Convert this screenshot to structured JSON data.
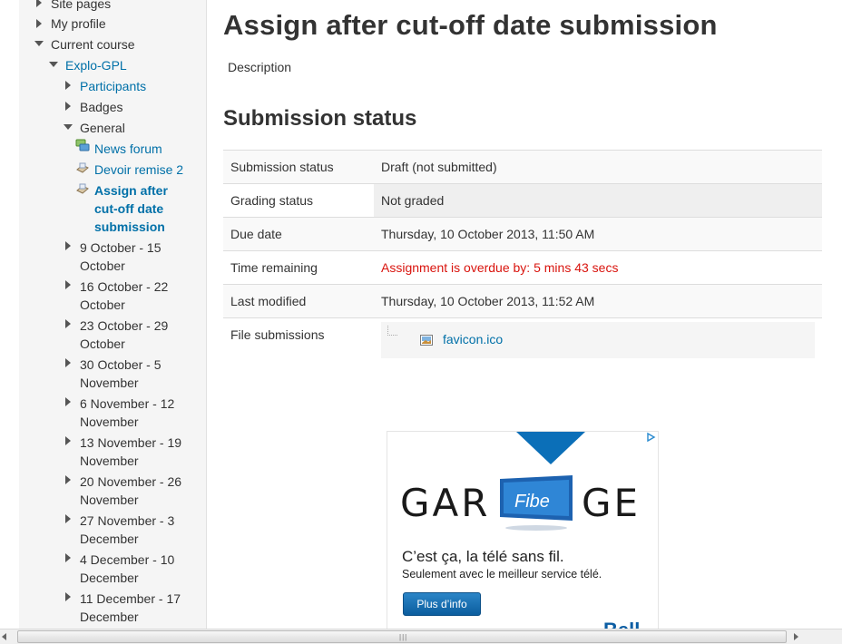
{
  "sidebar": {
    "site_pages": "Site pages",
    "my_profile": "My profile",
    "current_course": "Current course",
    "course_name": "Explo-GPL",
    "participants": "Participants",
    "badges": "Badges",
    "general": "General",
    "news_forum": "News forum",
    "devoir": "Devoir remise 2",
    "assign_lines": [
      "Assign after",
      "cut-off date",
      "submission"
    ],
    "weeks": [
      [
        "9 October - 15",
        "October"
      ],
      [
        "16 October - 22",
        "October"
      ],
      [
        "23 October - 29",
        "October"
      ],
      [
        "30 October - 5",
        "November"
      ],
      [
        "6 November - 12",
        "November"
      ],
      [
        "13 November - 19",
        "November"
      ],
      [
        "20 November - 26",
        "November"
      ],
      [
        "27 November - 3",
        "December"
      ],
      [
        "4 December - 10",
        "December"
      ],
      [
        "11 December - 17",
        "December"
      ]
    ]
  },
  "main": {
    "title": "Assign after cut-off date submission",
    "description": "Description",
    "section_title": "Submission status",
    "rows": [
      {
        "label": "Submission status",
        "value": "Draft (not submitted)"
      },
      {
        "label": "Grading status",
        "value": "Not graded"
      },
      {
        "label": "Due date",
        "value": "Thursday, 10 October 2013, 11:50 AM"
      },
      {
        "label": "Time remaining",
        "value": "Assignment is overdue by: 5 mins 43 secs"
      },
      {
        "label": "Last modified",
        "value": "Thursday, 10 October 2013, 11:52 AM"
      },
      {
        "label": "File submissions",
        "value": "favicon.ico"
      }
    ]
  },
  "ad": {
    "letters_left": "GAR",
    "fibe": "Fibe",
    "letters_right": "GE",
    "tagline": "C’est ça, la télé sans fil.",
    "subline": "Seulement avec le meilleur service télé.",
    "cta": "Plus d’info",
    "brand": "Bell"
  },
  "colors": {
    "link": "#0070a8",
    "overdue": "#d9140e",
    "ad_blue": "#0b5da3"
  }
}
